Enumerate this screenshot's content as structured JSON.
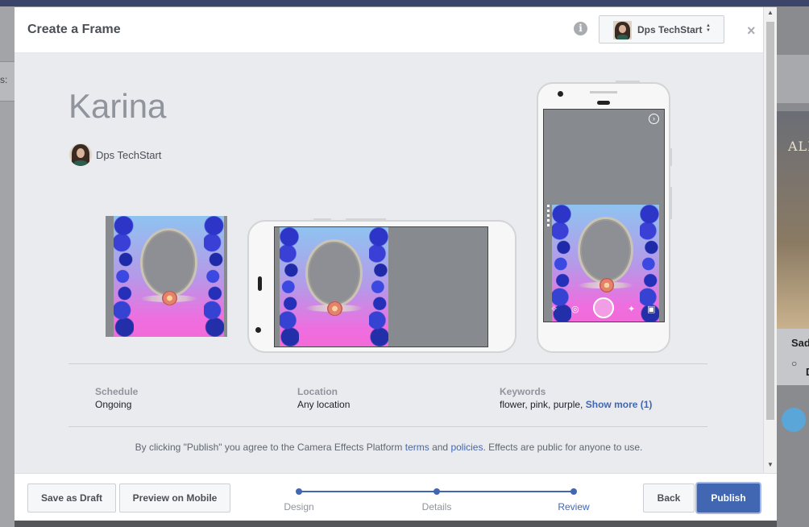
{
  "modal": {
    "title": "Create a Frame",
    "info_icon": "i",
    "close_icon": "×",
    "page_selector": {
      "label": "Dps TechStart",
      "caret": "▲▼"
    }
  },
  "effect": {
    "name": "Karina",
    "owner": "Dps TechStart"
  },
  "meta": {
    "schedule_label": "Schedule",
    "schedule_value": "Ongoing",
    "location_label": "Location",
    "location_value": "Any location",
    "keywords_label": "Keywords",
    "keywords_value": "flower, pink, purple,",
    "keywords_more": "Show more (1)"
  },
  "terms": {
    "prefix": "By clicking \"Publish\" you agree to the Camera Effects Platform",
    "terms_link": "terms",
    "and": "and",
    "policies_link": "policies",
    "suffix": ". Effects are public for anyone to use."
  },
  "footer": {
    "save_draft": "Save as Draft",
    "preview_mobile": "Preview on Mobile",
    "back": "Back",
    "publish": "Publish",
    "steps": [
      "Design",
      "Details",
      "Review"
    ],
    "active_step": "Review"
  },
  "background": {
    "left_stub_text": "s:",
    "right_card_title": "Sad",
    "right_card_sub": "D",
    "right_thumb_text": "ALDS"
  },
  "colors": {
    "accent": "#4267b2",
    "content_bg": "#e9ebee"
  }
}
